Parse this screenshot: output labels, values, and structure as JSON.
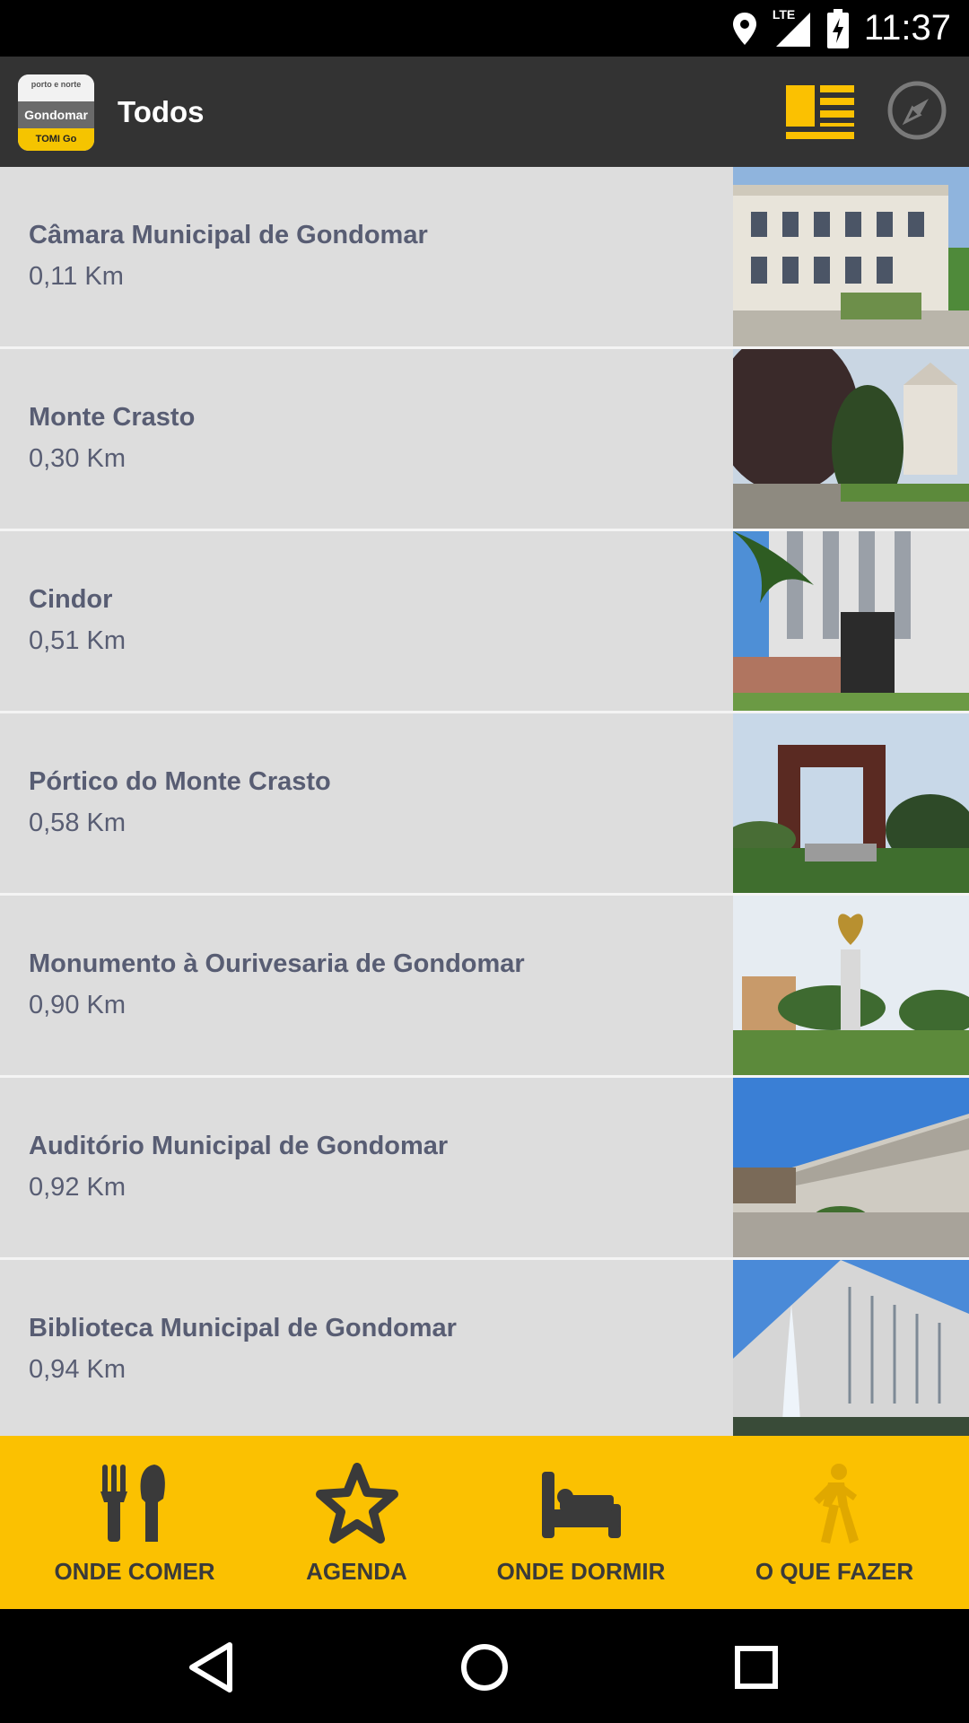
{
  "status_bar": {
    "time": "11:37",
    "network": "LTE",
    "icons": [
      "location-icon",
      "signal-icon",
      "battery-charging-icon"
    ]
  },
  "app_bar": {
    "logo": {
      "line1": "porto e norte",
      "line2": "Gondomar",
      "line3": "TOMI Go"
    },
    "title": "Todos",
    "actions": [
      "list-view-icon",
      "compass-icon"
    ]
  },
  "poi_list": [
    {
      "name": "Câmara Municipal de Gondomar",
      "distance": "0,11 Km"
    },
    {
      "name": "Monte Crasto",
      "distance": "0,30 Km"
    },
    {
      "name": "Cindor",
      "distance": "0,51 Km"
    },
    {
      "name": "Pórtico do Monte Crasto",
      "distance": "0,58 Km"
    },
    {
      "name": "Monumento à Ourivesaria de Gondomar",
      "distance": "0,90 Km"
    },
    {
      "name": "Auditório Municipal de Gondomar",
      "distance": "0,92 Km"
    },
    {
      "name": "Biblioteca Municipal de Gondomar",
      "distance": "0,94 Km"
    }
  ],
  "bottom_nav": [
    {
      "label": "ONDE COMER",
      "icon": "fork-knife-icon"
    },
    {
      "label": "AGENDA",
      "icon": "star-icon"
    },
    {
      "label": "ONDE DORMIR",
      "icon": "bed-icon"
    },
    {
      "label": "O QUE FAZER",
      "icon": "walking-person-icon"
    }
  ],
  "colors": {
    "accent": "#fbc101",
    "app_bar": "#333333",
    "list_bg": "#dddddd",
    "text": "#585d73"
  }
}
